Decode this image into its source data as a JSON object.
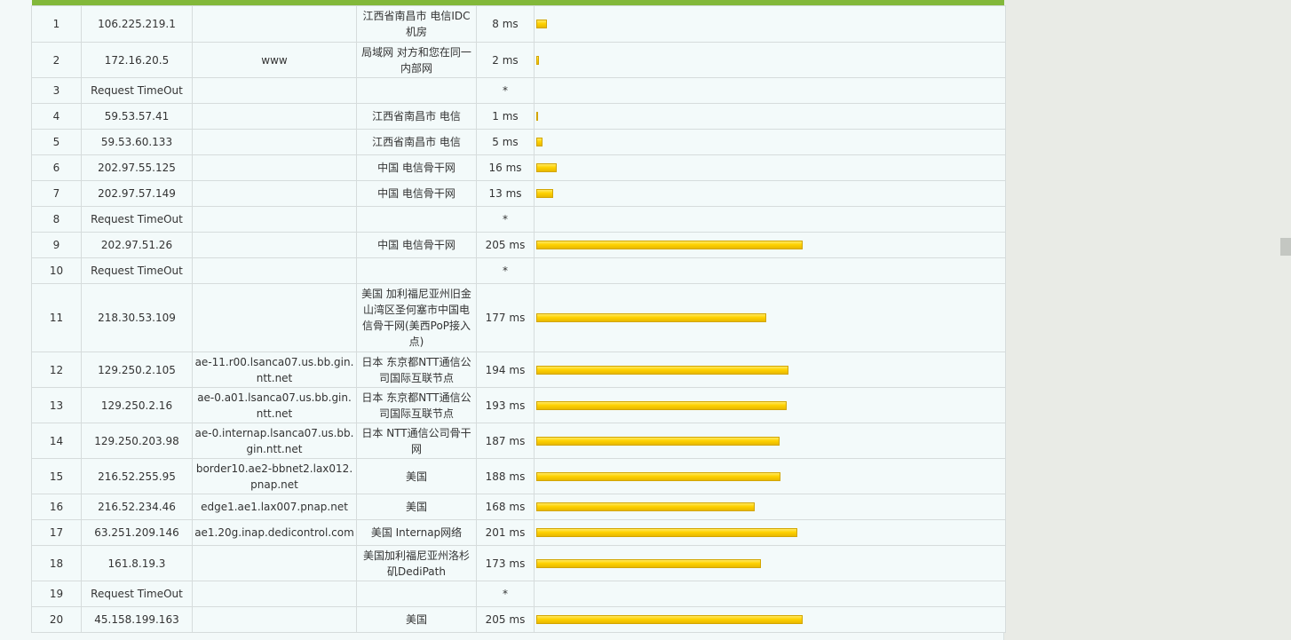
{
  "colors": {
    "header_accent": "#82b83a",
    "bar": "#ffd200"
  },
  "hops": [
    {
      "num": "1",
      "ip": "106.225.219.1",
      "host": "",
      "location": "江西省南昌市 电信IDC机房",
      "time": "8 ms",
      "ms": 8
    },
    {
      "num": "2",
      "ip": "172.16.20.5",
      "host": "www",
      "location": "局域网 对方和您在同一内部网",
      "time": "2 ms",
      "ms": 2
    },
    {
      "num": "3",
      "ip": "Request TimeOut",
      "host": "",
      "location": "",
      "time": "*",
      "ms": 0
    },
    {
      "num": "4",
      "ip": "59.53.57.41",
      "host": "",
      "location": "江西省南昌市 电信",
      "time": "1 ms",
      "ms": 1
    },
    {
      "num": "5",
      "ip": "59.53.60.133",
      "host": "",
      "location": "江西省南昌市 电信",
      "time": "5 ms",
      "ms": 5
    },
    {
      "num": "6",
      "ip": "202.97.55.125",
      "host": "",
      "location": "中国 电信骨干网",
      "time": "16 ms",
      "ms": 16
    },
    {
      "num": "7",
      "ip": "202.97.57.149",
      "host": "",
      "location": "中国 电信骨干网",
      "time": "13 ms",
      "ms": 13
    },
    {
      "num": "8",
      "ip": "Request TimeOut",
      "host": "",
      "location": "",
      "time": "*",
      "ms": 0
    },
    {
      "num": "9",
      "ip": "202.97.51.26",
      "host": "",
      "location": "中国 电信骨干网",
      "time": "205 ms",
      "ms": 205
    },
    {
      "num": "10",
      "ip": "Request TimeOut",
      "host": "",
      "location": "",
      "time": "*",
      "ms": 0
    },
    {
      "num": "11",
      "ip": "218.30.53.109",
      "host": "",
      "location": "美国 加利福尼亚州旧金山湾区圣何塞市中国电信骨干网(美西PoP接入点)",
      "time": "177 ms",
      "ms": 177
    },
    {
      "num": "12",
      "ip": "129.250.2.105",
      "host": "ae-11.r00.lsanca07.us.bb.gin.ntt.net",
      "location": "日本 东京都NTT通信公司国际互联节点",
      "time": "194 ms",
      "ms": 194
    },
    {
      "num": "13",
      "ip": "129.250.2.16",
      "host": "ae-0.a01.lsanca07.us.bb.gin.ntt.net",
      "location": "日本 东京都NTT通信公司国际互联节点",
      "time": "193 ms",
      "ms": 193
    },
    {
      "num": "14",
      "ip": "129.250.203.98",
      "host": "ae-0.internap.lsanca07.us.bb.gin.ntt.net",
      "location": "日本 NTT通信公司骨干网",
      "time": "187 ms",
      "ms": 187
    },
    {
      "num": "15",
      "ip": "216.52.255.95",
      "host": "border10.ae2-bbnet2.lax012.pnap.net",
      "location": "美国",
      "time": "188 ms",
      "ms": 188
    },
    {
      "num": "16",
      "ip": "216.52.234.46",
      "host": "edge1.ae1.lax007.pnap.net",
      "location": "美国",
      "time": "168 ms",
      "ms": 168
    },
    {
      "num": "17",
      "ip": "63.251.209.146",
      "host": "ae1.20g.inap.dedicontrol.com",
      "location": "美国 Internap网络",
      "time": "201 ms",
      "ms": 201
    },
    {
      "num": "18",
      "ip": "161.8.19.3",
      "host": "",
      "location": "美国加利福尼亚州洛杉矶DediPath",
      "time": "173 ms",
      "ms": 173
    },
    {
      "num": "19",
      "ip": "Request TimeOut",
      "host": "",
      "location": "",
      "time": "*",
      "ms": 0
    },
    {
      "num": "20",
      "ip": "45.158.199.163",
      "host": "",
      "location": "美国",
      "time": "205 ms",
      "ms": 205
    }
  ]
}
